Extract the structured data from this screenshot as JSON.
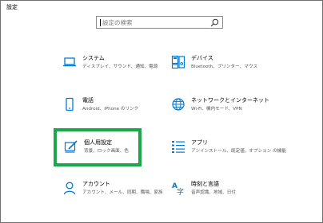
{
  "window": {
    "title": "設定"
  },
  "search": {
    "placeholder": "設定の検索"
  },
  "items": [
    {
      "title": "システム",
      "desc": "ディスプレイ、サウンド、通知、電源",
      "icon": "laptop-icon"
    },
    {
      "title": "デバイス",
      "desc": "Bluetooth、プリンター、マウス",
      "icon": "keyboard-icon"
    },
    {
      "title": "電話",
      "desc": "Android、iPhone のリンク",
      "icon": "phone-icon"
    },
    {
      "title": "ネットワークとインターネット",
      "desc": "Wi-Fi、機内モード、VPN",
      "icon": "globe-icon"
    },
    {
      "title": "個人用設定",
      "desc": "背景、ロック画面、色",
      "icon": "personalization-icon"
    },
    {
      "title": "アプリ",
      "desc": "アンインストール、既定値、オプション の機能",
      "icon": "apps-list-icon"
    },
    {
      "title": "アカウント",
      "desc": "アカウント、メール、同期、職場、家族",
      "icon": "person-icon"
    },
    {
      "title": "時刻と言語",
      "desc": "音声認識、地域、日付",
      "icon": "time-language-icon"
    }
  ],
  "colors": {
    "accent": "#0078d7",
    "highlight": "#1aa84a"
  }
}
